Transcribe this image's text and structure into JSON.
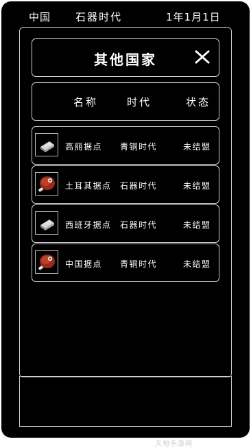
{
  "status_bar": {
    "country": "中国",
    "era": "石器时代",
    "date": "1年1月1日"
  },
  "dialog": {
    "title": "其他国家",
    "close_icon": "close-x-icon"
  },
  "table": {
    "columns": [
      "名称",
      "时代",
      "状态"
    ],
    "rows": [
      {
        "icon": "ingot-icon",
        "name": "高丽据点",
        "era": "青铜时代",
        "status": "未结盟"
      },
      {
        "icon": "meat-icon",
        "name": "土耳其据点",
        "era": "石器时代",
        "status": "未结盟"
      },
      {
        "icon": "ingot-icon",
        "name": "西班牙据点",
        "era": "石器时代",
        "status": "未结盟"
      },
      {
        "icon": "meat-icon",
        "name": "中国据点",
        "era": "青铜时代",
        "status": "未结盟"
      }
    ]
  },
  "watermark": "天地手游网",
  "colors": {
    "background": "#000000",
    "border": "#cfcfcf",
    "text": "#ffffff",
    "meat": "#9a2b16"
  }
}
